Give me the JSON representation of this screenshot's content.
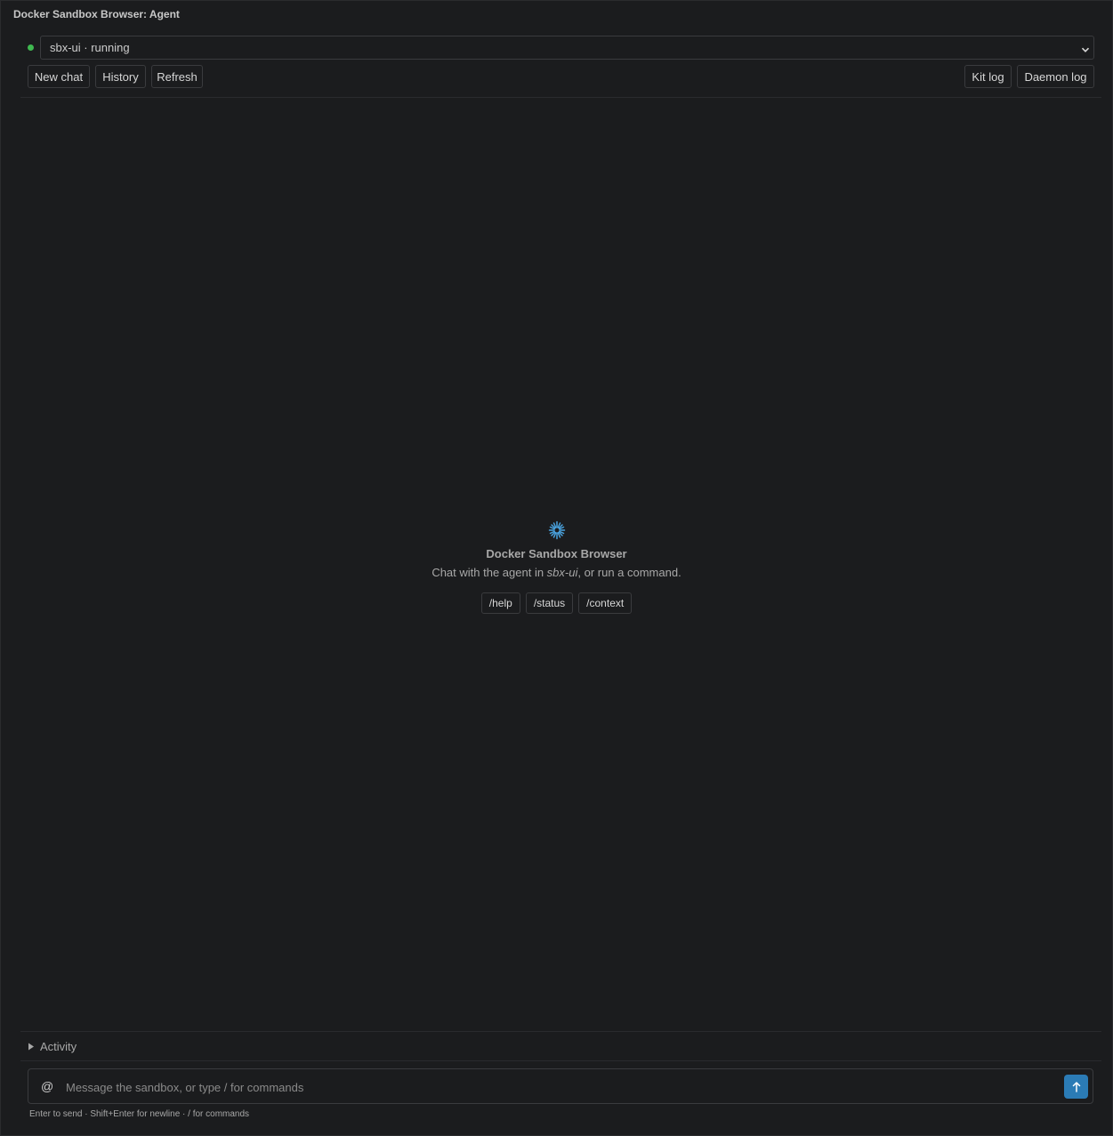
{
  "window": {
    "title": "Docker Sandbox Browser: Agent"
  },
  "sandbox": {
    "status_color": "#3fb950",
    "selected": "sbx-ui · running"
  },
  "toolbar": {
    "new_chat": "New chat",
    "history": "History",
    "refresh": "Refresh",
    "kit_log": "Kit log",
    "daemon_log": "Daemon log"
  },
  "empty_state": {
    "icon": "sparkle-logo-icon",
    "title": "Docker Sandbox Browser",
    "subtitle_prefix": "Chat with the agent in ",
    "subtitle_sandbox": "sbx-ui",
    "subtitle_suffix": ", or run a command.",
    "commands": [
      "/help",
      "/status",
      "/context"
    ]
  },
  "activity": {
    "label": "Activity"
  },
  "composer": {
    "mention_symbol": "@",
    "placeholder": "Message the sandbox, or type / for commands",
    "value": "",
    "send_icon": "arrow-up-icon",
    "accent": "#2b7bb5",
    "hint": "Enter to send · Shift+Enter for newline · / for commands"
  }
}
